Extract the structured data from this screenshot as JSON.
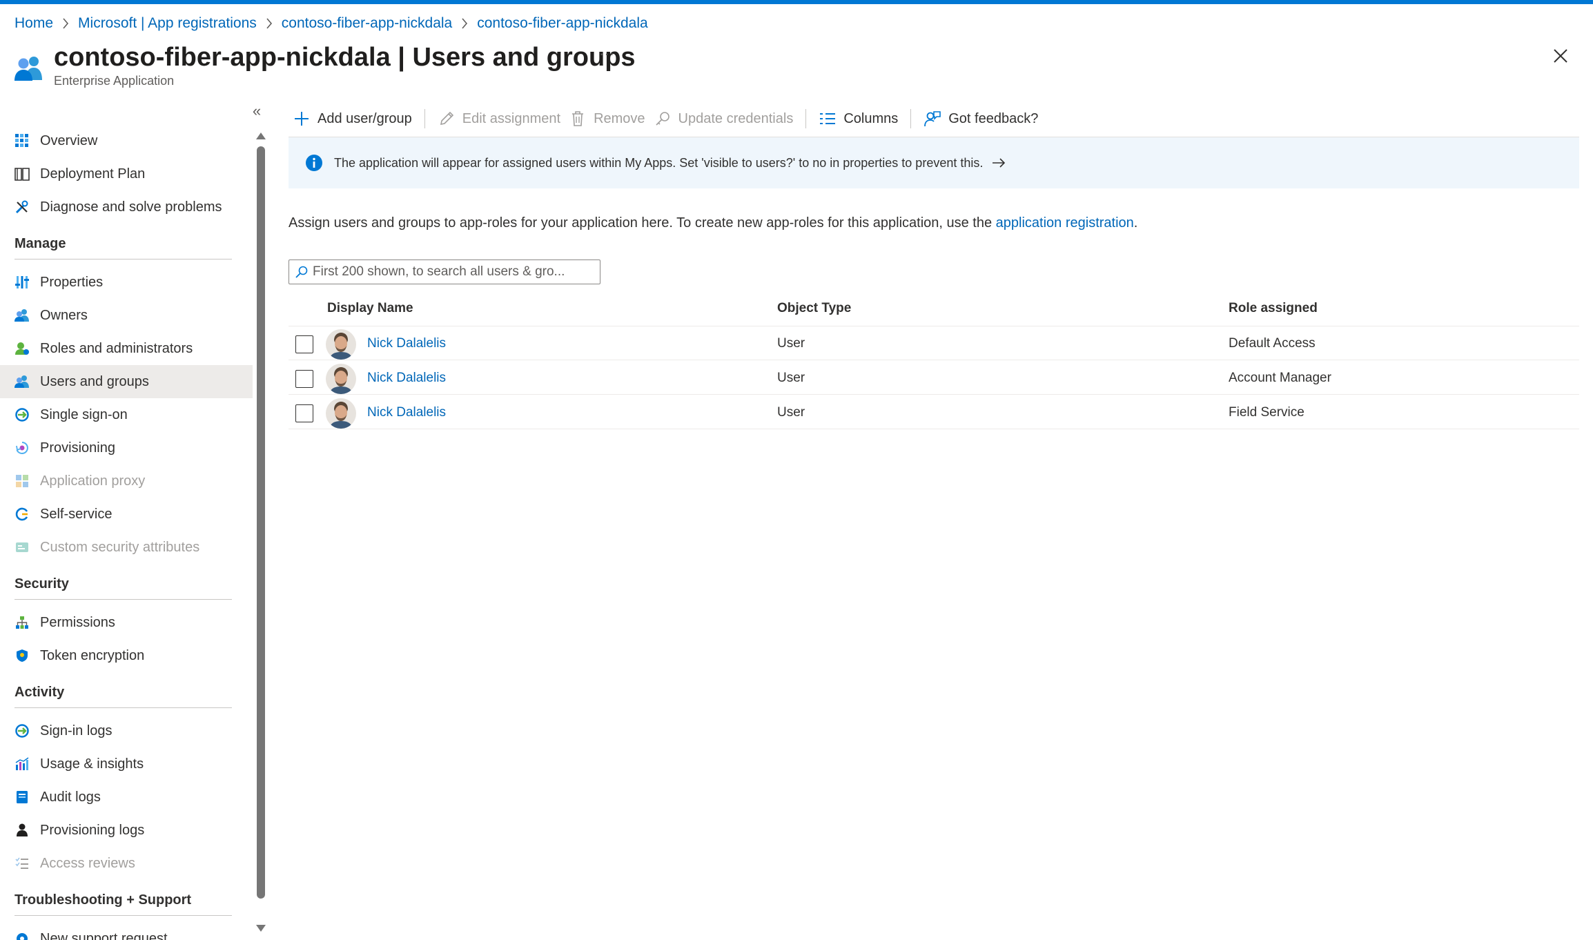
{
  "breadcrumb": {
    "items": [
      "Home",
      "Microsoft | App registrations",
      "contoso-fiber-app-nickdala",
      "contoso-fiber-app-nickdala"
    ]
  },
  "header": {
    "app_name": "contoso-fiber-app-nickdala",
    "separator": " | ",
    "page_name": "Users and groups",
    "subtitle": "Enterprise Application",
    "more": "···"
  },
  "sidebar": {
    "collapse_label": "«",
    "items": [
      {
        "label": "Overview",
        "icon": "overview-grid-icon"
      },
      {
        "label": "Deployment Plan",
        "icon": "book-icon"
      },
      {
        "label": "Diagnose and solve problems",
        "icon": "tools-icon"
      }
    ],
    "sections": [
      {
        "title": "Manage",
        "items": [
          {
            "label": "Properties",
            "icon": "properties-icon"
          },
          {
            "label": "Owners",
            "icon": "owners-icon"
          },
          {
            "label": "Roles and administrators",
            "icon": "roles-icon"
          },
          {
            "label": "Users and groups",
            "icon": "users-groups-icon",
            "selected": true
          },
          {
            "label": "Single sign-on",
            "icon": "sso-icon"
          },
          {
            "label": "Provisioning",
            "icon": "provisioning-icon"
          },
          {
            "label": "Application proxy",
            "icon": "app-proxy-icon",
            "disabled": true
          },
          {
            "label": "Self-service",
            "icon": "self-service-icon"
          },
          {
            "label": "Custom security attributes",
            "icon": "custom-attributes-icon",
            "disabled": true
          }
        ]
      },
      {
        "title": "Security",
        "items": [
          {
            "label": "Permissions",
            "icon": "permissions-icon"
          },
          {
            "label": "Token encryption",
            "icon": "shield-icon"
          }
        ]
      },
      {
        "title": "Activity",
        "items": [
          {
            "label": "Sign-in logs",
            "icon": "sign-in-logs-icon"
          },
          {
            "label": "Usage & insights",
            "icon": "usage-chart-icon"
          },
          {
            "label": "Audit logs",
            "icon": "audit-logs-icon"
          },
          {
            "label": "Provisioning logs",
            "icon": "provisioning-logs-icon"
          },
          {
            "label": "Access reviews",
            "icon": "access-reviews-icon",
            "disabled": true
          }
        ]
      },
      {
        "title": "Troubleshooting + Support",
        "items": [
          {
            "label": "New support request",
            "icon": "support-icon"
          }
        ]
      }
    ]
  },
  "toolbar": {
    "add_label": "Add user/group",
    "edit_label": "Edit assignment",
    "remove_label": "Remove",
    "update_label": "Update credentials",
    "columns_label": "Columns",
    "feedback_label": "Got feedback?"
  },
  "banner": {
    "text": "The application will appear for assigned users within My Apps. Set 'visible to users?' to no in properties to prevent this."
  },
  "description": {
    "text": "Assign users and groups to app-roles for your application here. To create new app-roles for this application, use the ",
    "link": "application registration",
    "suffix": "."
  },
  "search": {
    "placeholder": "First 200 shown, to search all users & gro..."
  },
  "table": {
    "columns": [
      "Display Name",
      "Object Type",
      "Role assigned"
    ],
    "rows": [
      {
        "name": "Nick Dalalelis",
        "type": "User",
        "role": "Default Access"
      },
      {
        "name": "Nick Dalalelis",
        "type": "User",
        "role": "Account Manager"
      },
      {
        "name": "Nick Dalalelis",
        "type": "User",
        "role": "Field Service"
      }
    ]
  },
  "colors": {
    "accent": "#0078d4",
    "link": "#0067b8",
    "selected_bg": "#edebe9",
    "banner_bg": "#eff6fc"
  }
}
